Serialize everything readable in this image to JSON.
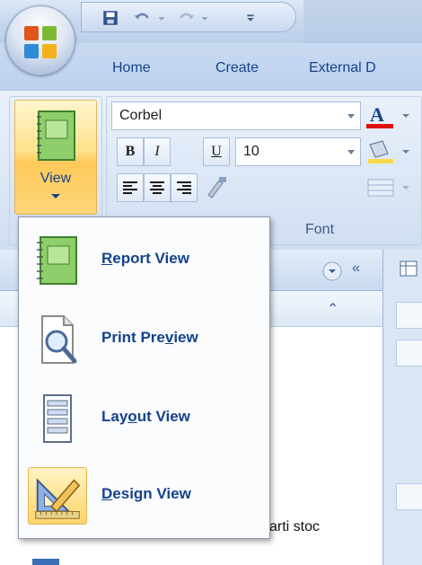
{
  "tabs": [
    "Home",
    "Create",
    "External D"
  ],
  "views_group": {
    "view_label": "View"
  },
  "font_group": {
    "font_name": "Corbel",
    "font_size": "10",
    "bold_label": "B",
    "italic_label": "I",
    "underline_label": "U",
    "group_label": "Font"
  },
  "nav_pane": {
    "chevron_label": "«",
    "collapse_label": "⌃",
    "partial_item": "arti stoc"
  },
  "view_menu": {
    "items": [
      {
        "pre": "",
        "mnemonic": "R",
        "post": "eport View",
        "icon": "report-view-icon"
      },
      {
        "pre": "Print Pre",
        "mnemonic": "v",
        "post": "iew",
        "icon": "print-preview-icon"
      },
      {
        "pre": "Lay",
        "mnemonic": "o",
        "post": "ut View",
        "icon": "layout-view-icon"
      },
      {
        "pre": "",
        "mnemonic": "D",
        "post": "esign View",
        "icon": "design-view-icon",
        "active": true
      }
    ]
  },
  "colors": {
    "accent": "#15428b",
    "highlight": "#ffd46a",
    "font_color_bar": "#e01010"
  }
}
